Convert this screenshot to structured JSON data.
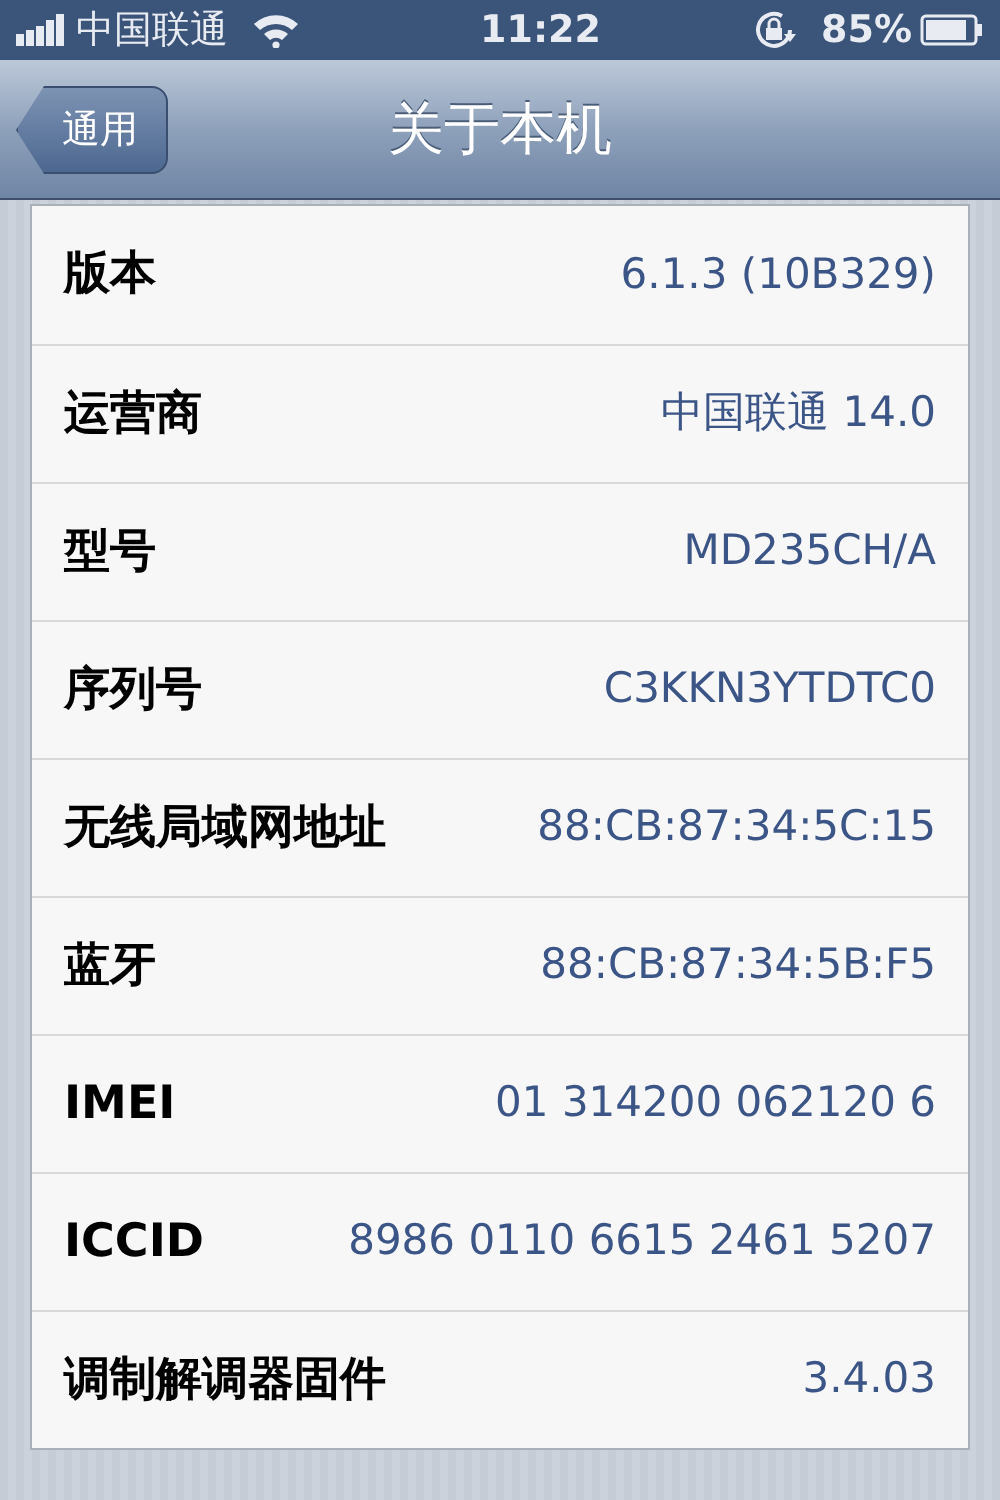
{
  "status_bar": {
    "carrier": "中国联通",
    "time": "11:22",
    "battery": "85%"
  },
  "nav_bar": {
    "back": "通用",
    "title": "关于本机"
  },
  "rows": [
    {
      "label": "版本",
      "value": "6.1.3 (10B329)"
    },
    {
      "label": "运营商",
      "value": "中国联通 14.0"
    },
    {
      "label": "型号",
      "value": "MD235CH/A"
    },
    {
      "label": "序列号",
      "value": "C3KKN3YTDTC0"
    },
    {
      "label": "无线局域网地址",
      "value": "88:CB:87:34:5C:15"
    },
    {
      "label": "蓝牙",
      "value": "88:CB:87:34:5B:F5"
    },
    {
      "label": "IMEI",
      "value": "01 314200 062120 6"
    },
    {
      "label": "ICCID",
      "value": "8986 0110 6615 2461 5207"
    },
    {
      "label": "调制解调器固件",
      "value": "3.4.03"
    }
  ]
}
